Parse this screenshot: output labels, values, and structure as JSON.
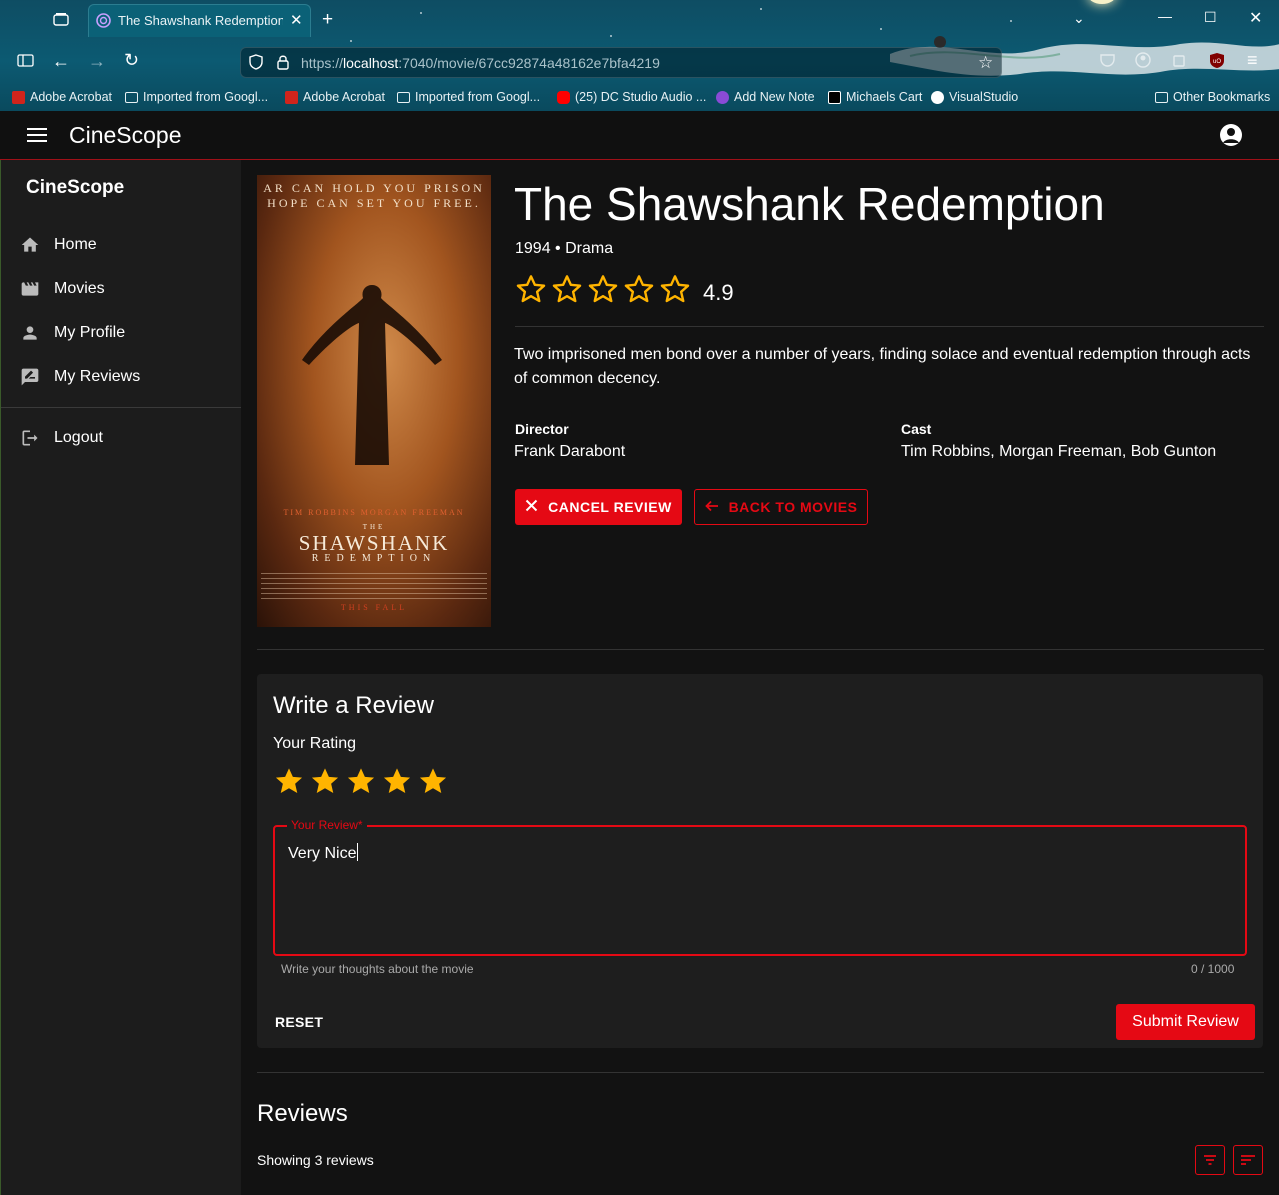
{
  "browser": {
    "tab_title": "The Shawshank Redemption - C",
    "url_prefix": "https://",
    "url_host": "localhost",
    "url_rest": ":7040/movie/67cc92874a48162e7bfa4219",
    "bookmarks": [
      {
        "label": "Adobe Acrobat",
        "icon": "adobe-icon",
        "color": "#d1241c"
      },
      {
        "label": "Imported from Googl...",
        "icon": "folder-icon",
        "color": ""
      },
      {
        "label": "Adobe Acrobat",
        "icon": "adobe-icon",
        "color": "#d1241c"
      },
      {
        "label": "Imported from Googl...",
        "icon": "folder-icon",
        "color": ""
      },
      {
        "label": "(25) DC Studio Audio ...",
        "icon": "youtube-icon",
        "color": "#ff0000"
      },
      {
        "label": "Add New Note",
        "icon": "onenote-icon",
        "color": "#8a4bd6"
      },
      {
        "label": "Michaels Cart",
        "icon": "michaels-icon",
        "color": "#000000"
      },
      {
        "label": "VisualStudio",
        "icon": "github-icon",
        "color": "#ffffff"
      }
    ],
    "other_bookmarks": "Other Bookmarks"
  },
  "app": {
    "brand": "CineScope",
    "accent": "#e50914"
  },
  "sidebar": {
    "title": "CineScope",
    "items": [
      {
        "label": "Home",
        "icon": "home-icon"
      },
      {
        "label": "Movies",
        "icon": "movie-clapper-icon"
      },
      {
        "label": "My Profile",
        "icon": "person-icon"
      },
      {
        "label": "My Reviews",
        "icon": "rate-review-icon"
      }
    ],
    "logout": {
      "label": "Logout",
      "icon": "logout-icon"
    }
  },
  "movie": {
    "title": "The Shawshank Redemption",
    "meta": "1994 • Drama",
    "rating_value": "4.9",
    "stars_filled": 0,
    "stars_total": 5,
    "description": "Two imprisoned men bond over a number of years, finding solace and eventual redemption through acts of common decency.",
    "director_label": "Director",
    "director": "Frank Darabont",
    "cast_label": "Cast",
    "cast": "Tim Robbins, Morgan Freeman, Bob Gunton",
    "poster": {
      "tagline_1": "AR CAN HOLD YOU PRISON",
      "tagline_2": "HOPE CAN SET YOU FREE.",
      "cast_line": "TIM ROBBINS     MORGAN FREEMAN",
      "the": "THE",
      "title": "SHAWSHANK",
      "subtitle": "REDEMPTION",
      "release": "THIS FALL"
    }
  },
  "actions": {
    "cancel_review": "CANCEL REVIEW",
    "back_to_movies": "BACK TO MOVIES"
  },
  "review_form": {
    "title": "Write a Review",
    "rating_label": "Your Rating",
    "rating": 5,
    "field_label": "Your Review*",
    "value": "Very Nice",
    "helper": "Write your thoughts about the movie",
    "counter": "0 / 1000",
    "reset": "RESET",
    "submit": "Submit Review"
  },
  "reviews": {
    "title": "Reviews",
    "count_text": "Showing 3 reviews"
  }
}
